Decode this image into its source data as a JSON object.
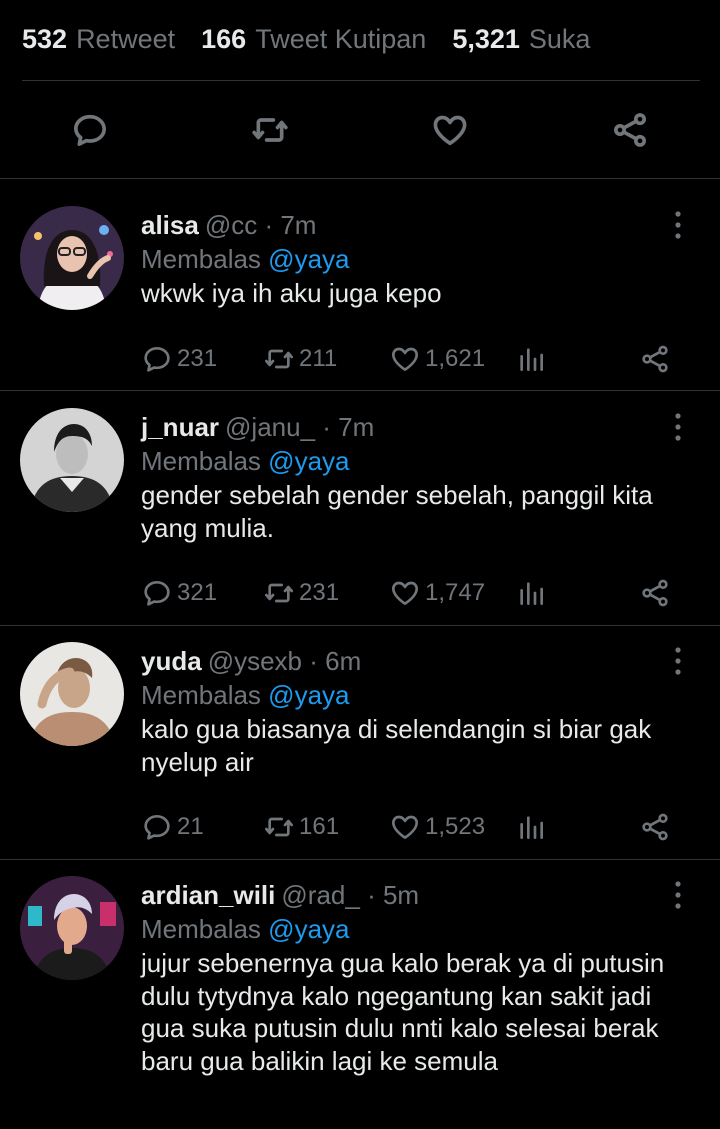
{
  "stats": {
    "retweets": {
      "count": "532",
      "label": "Retweet"
    },
    "quotes": {
      "count": "166",
      "label": "Tweet Kutipan"
    },
    "likes": {
      "count": "5,321",
      "label": "Suka"
    }
  },
  "replies": [
    {
      "name": "alisa",
      "handle": "@cc",
      "time": "· 7m",
      "replying_prefix": "Membalas",
      "replying_to": "@yaya",
      "text": "wkwk iya ih aku juga kepo",
      "replies": "231",
      "retweets": "211",
      "likes": "1,621",
      "avatar": {
        "bg": "#3a2a4a",
        "skin": "#e8c3b0",
        "hair": "#1a1416",
        "clothes": "#f0eef0"
      }
    },
    {
      "name": "j_nuar",
      "handle": "@janu_",
      "time": "· 7m",
      "replying_prefix": "Membalas",
      "replying_to": "@yaya",
      "text": "gender sebelah gender sebelah, panggil kita yang mulia.",
      "replies": "321",
      "retweets": "231",
      "likes": "1,747",
      "avatar": {
        "bg": "#cfcfcf",
        "skin": "#bdbdbd",
        "hair": "#1c1c1c",
        "clothes": "#2a2a2a"
      }
    },
    {
      "name": "yuda",
      "handle": "@ysexb",
      "time": "· 6m",
      "replying_prefix": "Membalas",
      "replying_to": "@yaya",
      "text": "kalo gua biasanya di selendangin si biar gak nyelup air",
      "replies": "21",
      "retweets": "161",
      "likes": "1,523",
      "avatar": {
        "bg": "#e9e7e3",
        "skin": "#c8a488",
        "hair": "#7a5a42",
        "clothes": "#b98e72"
      }
    },
    {
      "name": "ardian_wili",
      "handle": "@rad_",
      "time": "· 5m",
      "replying_prefix": "Membalas",
      "replying_to": "@yaya",
      "text": "jujur sebenernya gua kalo berak ya di putusin dulu tytydnya kalo ngegantung kan sakit jadi gua suka putusin dulu nnti kalo selesai berak baru gua balikin lagi ke semula",
      "avatar": {
        "bg": "#3a1f3e",
        "skin": "#e2a98c",
        "hair": "#d5d2e8",
        "clothes": "#1b1b1b"
      }
    }
  ],
  "icons": {
    "reply": "speech-bubble-icon",
    "retweet": "retweet-icon",
    "like": "heart-icon",
    "share": "share-icon",
    "analytics": "bar-chart-icon",
    "more": "kebab-menu-icon"
  },
  "colors": {
    "muted": "#71767b",
    "mention": "#1d9bf0",
    "divider": "#2f3336"
  }
}
